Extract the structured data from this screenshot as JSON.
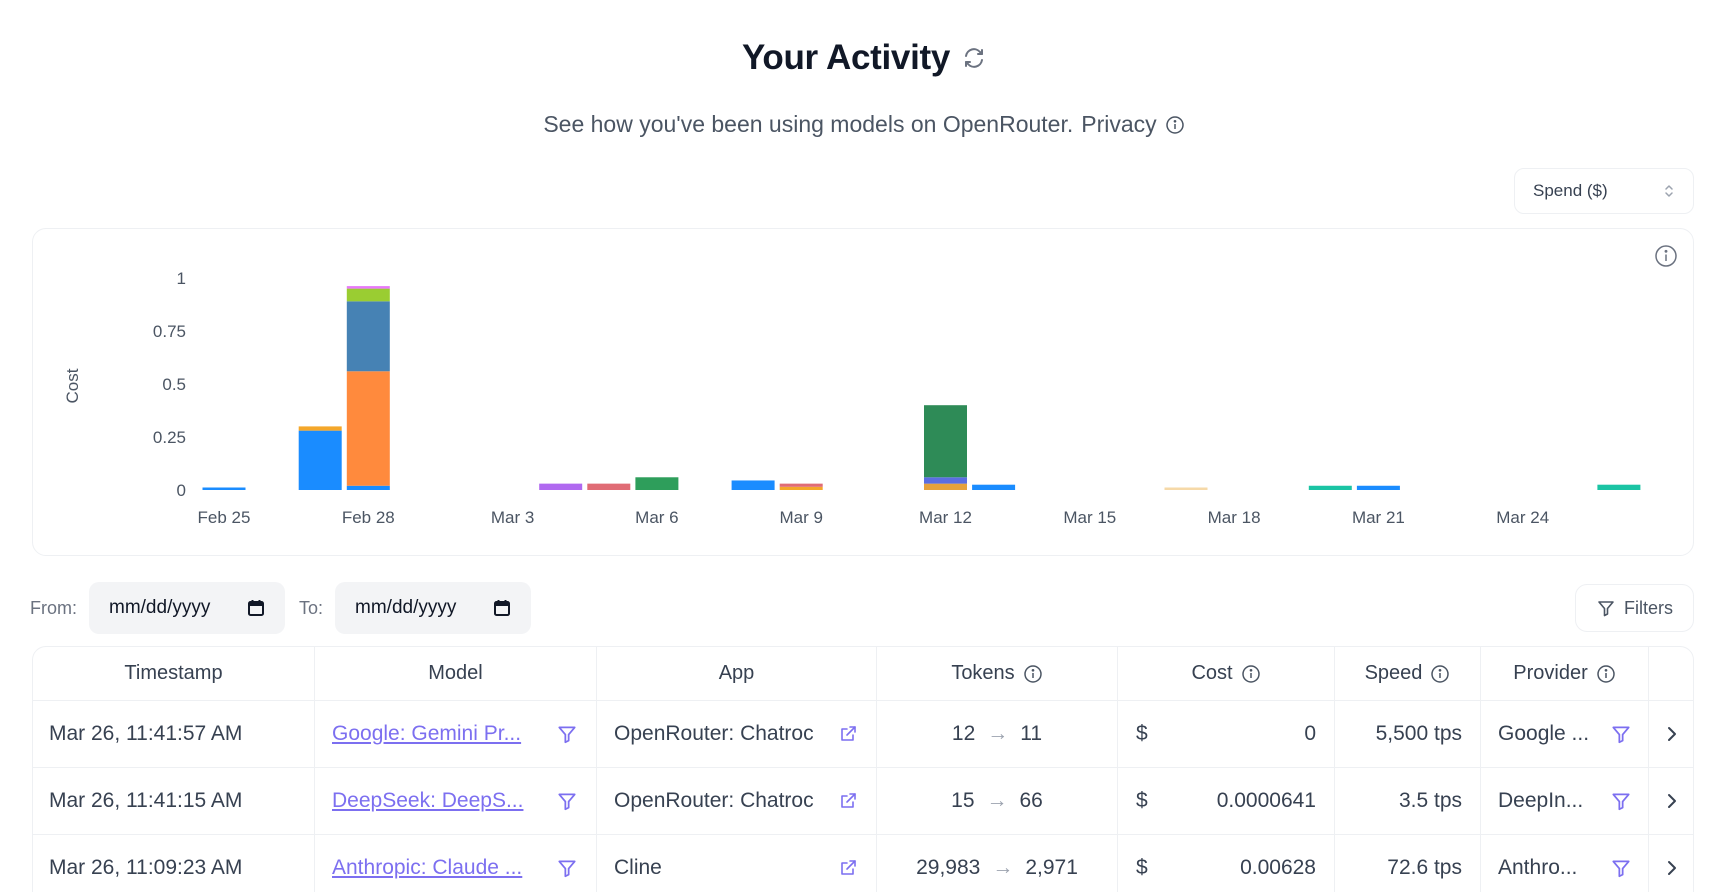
{
  "header": {
    "title": "Your Activity",
    "subtitle": "See how you've been using models on OpenRouter.",
    "privacy_label": "Privacy"
  },
  "metric_select": {
    "value": "Spend ($)"
  },
  "filters": {
    "from_label": "From:",
    "to_label": "To:",
    "from_placeholder": "mm/dd/yyyy",
    "to_placeholder": "mm/dd/yyyy",
    "filters_label": "Filters"
  },
  "chart_data": {
    "type": "bar",
    "stacked": true,
    "ylabel": "Cost",
    "ylim": [
      0,
      1
    ],
    "yticks": [
      0,
      0.25,
      0.5,
      0.75,
      1
    ],
    "ytick_labels": [
      "0",
      "0.25",
      "0.5",
      "0.75",
      "1"
    ],
    "grid": false,
    "categories": [
      "Feb 25",
      "Feb 26",
      "Feb 27",
      "Feb 28",
      "Mar 1",
      "Mar 2",
      "Mar 3",
      "Mar 4",
      "Mar 5",
      "Mar 6",
      "Mar 7",
      "Mar 8",
      "Mar 9",
      "Mar 10",
      "Mar 11",
      "Mar 12",
      "Mar 13",
      "Mar 14",
      "Mar 15",
      "Mar 16",
      "Mar 17",
      "Mar 18",
      "Mar 19",
      "Mar 20",
      "Mar 21",
      "Mar 22",
      "Mar 23",
      "Mar 24",
      "Mar 25",
      "Mar 26"
    ],
    "x_tick_labels": [
      "Feb 25",
      "Feb 28",
      "Mar 3",
      "Mar 6",
      "Mar 9",
      "Mar 12",
      "Mar 15",
      "Mar 18",
      "Mar 21",
      "Mar 24"
    ],
    "bars": [
      {
        "category": "Feb 25",
        "segments": [
          {
            "value": 0.01,
            "color": "#1a8cff"
          }
        ]
      },
      {
        "category": "Feb 27",
        "segments": [
          {
            "value": 0.28,
            "color": "#1a8cff"
          },
          {
            "value": 0.02,
            "color": "#f4a72a"
          }
        ]
      },
      {
        "category": "Feb 28",
        "segments": [
          {
            "value": 0.02,
            "color": "#1a8cff"
          },
          {
            "value": 0.54,
            "color": "#ff8a3d"
          },
          {
            "value": 0.33,
            "color": "#4682b4"
          },
          {
            "value": 0.06,
            "color": "#9acd32"
          },
          {
            "value": 0.01,
            "color": "#e879f9"
          }
        ]
      },
      {
        "category": "Mar 4",
        "segments": [
          {
            "value": 0.03,
            "color": "#b069f0"
          }
        ]
      },
      {
        "category": "Mar 5",
        "segments": [
          {
            "value": 0.03,
            "color": "#e06c75"
          }
        ]
      },
      {
        "category": "Mar 6",
        "segments": [
          {
            "value": 0.06,
            "color": "#2e9e5b"
          }
        ]
      },
      {
        "category": "Mar 8",
        "segments": [
          {
            "value": 0.045,
            "color": "#1a8cff"
          }
        ]
      },
      {
        "category": "Mar 9",
        "segments": [
          {
            "value": 0.015,
            "color": "#f4a72a"
          },
          {
            "value": 0.015,
            "color": "#e06c75"
          }
        ]
      },
      {
        "category": "Mar 12",
        "segments": [
          {
            "value": 0.03,
            "color": "#e6a23c"
          },
          {
            "value": 0.03,
            "color": "#5b6ee1"
          },
          {
            "value": 0.34,
            "color": "#2e8b57"
          }
        ]
      },
      {
        "category": "Mar 13",
        "segments": [
          {
            "value": 0.025,
            "color": "#1a8cff"
          }
        ]
      },
      {
        "category": "Mar 17",
        "segments": [
          {
            "value": 0.008,
            "color": "#f6d9a8"
          }
        ]
      },
      {
        "category": "Mar 20",
        "segments": [
          {
            "value": 0.02,
            "color": "#1bc4a4"
          }
        ]
      },
      {
        "category": "Mar 21",
        "segments": [
          {
            "value": 0.02,
            "color": "#1a8cff"
          }
        ]
      },
      {
        "category": "Mar 26",
        "segments": [
          {
            "value": 0.025,
            "color": "#1bc4a4"
          }
        ]
      }
    ]
  },
  "table": {
    "headers": {
      "timestamp": "Timestamp",
      "model": "Model",
      "app": "App",
      "tokens": "Tokens",
      "cost": "Cost",
      "speed": "Speed",
      "provider": "Provider"
    },
    "rows": [
      {
        "timestamp": "Mar 26, 11:41:57 AM",
        "model": "Google: Gemini Pr...",
        "app": "OpenRouter: Chatroc",
        "tokens_in": "12",
        "tokens_out": "11",
        "currency": "$",
        "cost": "0",
        "speed": "5,500 tps",
        "provider": "Google ..."
      },
      {
        "timestamp": "Mar 26, 11:41:15 AM",
        "model": "DeepSeek: DeepS...",
        "app": "OpenRouter: Chatroc",
        "tokens_in": "15",
        "tokens_out": "66",
        "currency": "$",
        "cost": "0.0000641",
        "speed": "3.5 tps",
        "provider": "DeepIn..."
      },
      {
        "timestamp": "Mar 26, 11:09:23 AM",
        "model": "Anthropic: Claude ...",
        "app": "Cline",
        "tokens_in": "29,983",
        "tokens_out": "2,971",
        "currency": "$",
        "cost": "0.00628",
        "speed": "72.6 tps",
        "provider": "Anthro..."
      }
    ],
    "arrow_glyph": "→"
  },
  "colors": {
    "accent_link": "#7c6ff0",
    "icon_accent": "#7c6ff0",
    "border": "#eef0f3"
  }
}
